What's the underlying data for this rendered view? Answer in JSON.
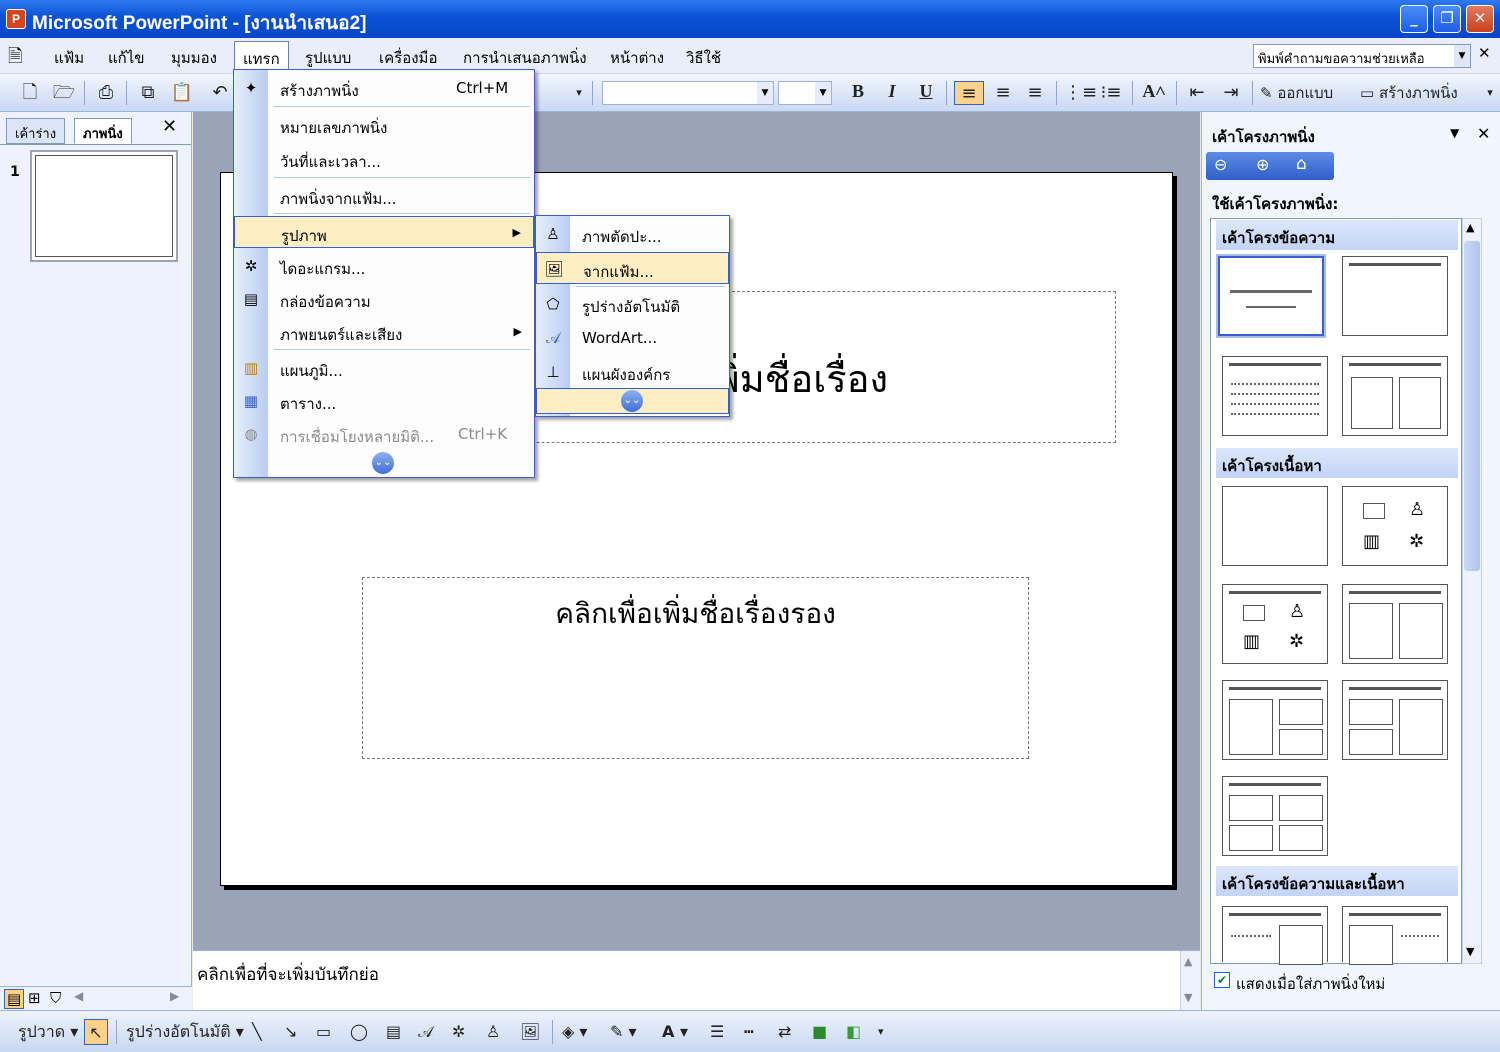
{
  "window": {
    "title": "Microsoft PowerPoint - [งานนำเสนอ2]",
    "app_icon": "powerpoint-icon",
    "buttons": {
      "minimize": "_",
      "restore": "❐",
      "close": "✕"
    }
  },
  "menubar": {
    "items": [
      "แฟ้ม",
      "แก้ไข",
      "มุมมอง",
      "แทรก",
      "รูปแบบ",
      "เครื่องมือ",
      "การนำเสนอภาพนิ่ง",
      "หน้าต่าง",
      "วิธีใช้"
    ],
    "active": "แทรก",
    "help_placeholder": "พิมพ์คำถามขอความช่วยเหลือ"
  },
  "toolbar": {
    "design_label": "ออกแบบ",
    "new_slide_label": "สร้างภาพนิ่ง",
    "bold": "B",
    "italic": "I",
    "underline": "U"
  },
  "insert_menu": {
    "items": [
      {
        "label": "สร้างภาพนิ่ง",
        "shortcut": "Ctrl+M",
        "icon": "new-slide-icon"
      },
      {
        "label": "หมายเลขภาพนิ่ง"
      },
      {
        "label": "วันที่และเวลา..."
      },
      {
        "label": "ภาพนิ่งจากแฟ้ม..."
      },
      {
        "label": "รูปภาพ",
        "submenu": true,
        "highlighted": true
      },
      {
        "label": "ไดอะแกรม...",
        "icon": "diagram-icon"
      },
      {
        "label": "กล่องข้อความ",
        "icon": "text-box-icon"
      },
      {
        "label": "ภาพยนตร์และเสียง",
        "submenu": true
      },
      {
        "label": "แผนภูมิ...",
        "icon": "chart-icon"
      },
      {
        "label": "ตาราง...",
        "icon": "table-icon"
      },
      {
        "label": "การเชื่อมโยงหลายมิติ...",
        "shortcut": "Ctrl+K",
        "disabled": true,
        "icon": "hyperlink-icon"
      }
    ]
  },
  "picture_submenu": {
    "items": [
      {
        "label": "ภาพตัดปะ...",
        "icon": "clip-art-icon"
      },
      {
        "label": "จากแฟ้ม...",
        "icon": "picture-from-file-icon",
        "highlighted": true
      },
      {
        "label": "รูปร่างอัตโนมัติ",
        "icon": "autoshape-icon"
      },
      {
        "label": "WordArt...",
        "icon": "wordart-icon"
      },
      {
        "label": "แผนผังองค์กร",
        "icon": "org-chart-icon"
      }
    ]
  },
  "left_panel": {
    "tabs": [
      "เค้าร่าง",
      "ภาพนิ่ง"
    ],
    "active_tab": "ภาพนิ่ง",
    "slide_number": "1"
  },
  "slide": {
    "title_placeholder": "คลิกเพื่อเพิ่มชื่อเรื่อง",
    "subtitle_placeholder": "คลิกเพื่อเพิ่มชื่อเรื่องรอง"
  },
  "notes": {
    "placeholder": "คลิกเพื่อที่จะเพิ่มบันทึกย่อ"
  },
  "task_pane": {
    "title": "เค้าโครงภาพนิ่ง",
    "apply_label": "ใช้เค้าโครงภาพนิ่ง:",
    "sections": [
      "เค้าโครงข้อความ",
      "เค้าโครงเนื้อหา",
      "เค้าโครงข้อความและเนื้อหา"
    ],
    "show_on_insert_label": "แสดงเมื่อใส่ภาพนิ่งใหม่",
    "show_on_insert_checked": true
  },
  "drawing_toolbar": {
    "draw_label": "รูปวาด",
    "autoshapes_label": "รูปร่างอัตโนมัติ"
  }
}
